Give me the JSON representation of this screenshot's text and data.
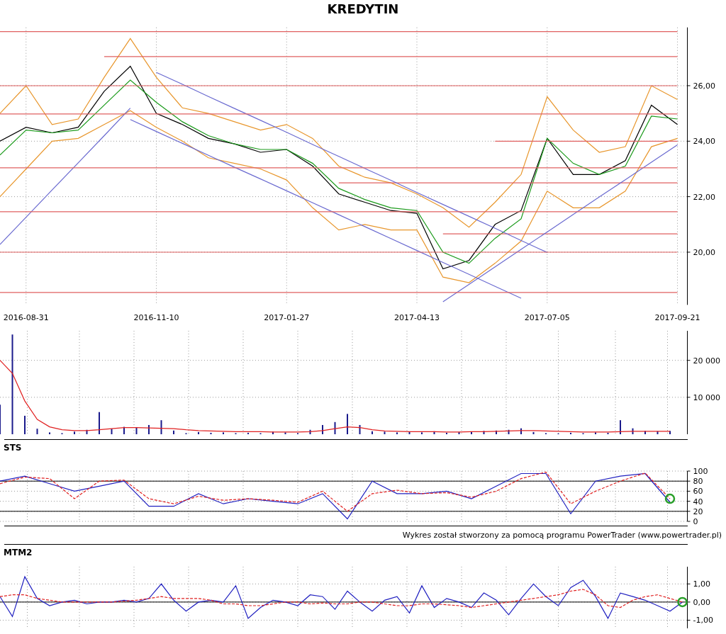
{
  "title": "KREDYTIN",
  "price": {
    "chart_data": {
      "type": "line",
      "grid": true,
      "ylim": [
        18.1,
        28.1
      ],
      "categories": [
        null,
        "2016-08-31",
        null,
        null,
        null,
        null,
        "2016-11-10",
        null,
        null,
        null,
        null,
        "2017-01-27",
        null,
        null,
        null,
        null,
        "2017-04-13",
        null,
        null,
        null,
        null,
        "2017-07-05",
        null,
        null,
        null,
        null,
        "2017-09-21"
      ],
      "yticks": [
        {
          "value": 20,
          "label": "20,00"
        },
        {
          "value": 22,
          "label": "22,00"
        },
        {
          "value": 24,
          "label": "24,00"
        },
        {
          "value": 26,
          "label": "26,00"
        }
      ],
      "series": [
        {
          "color": "#000000",
          "values": [
            24.0,
            24.5,
            24.3,
            24.5,
            25.8,
            26.7,
            25.0,
            24.6,
            24.1,
            23.9,
            23.6,
            23.7,
            23.1,
            22.1,
            21.8,
            21.5,
            21.4,
            19.4,
            19.7,
            21.0,
            21.5,
            24.1,
            22.8,
            22.8,
            23.3,
            25.3,
            24.6
          ]
        },
        {
          "color": "#1a9a1a",
          "values": [
            23.5,
            24.4,
            24.3,
            24.4,
            25.3,
            26.2,
            25.4,
            24.7,
            24.2,
            23.9,
            23.7,
            23.7,
            23.2,
            22.3,
            21.9,
            21.6,
            21.5,
            20.0,
            19.6,
            20.5,
            21.2,
            24.1,
            23.2,
            22.8,
            23.1,
            24.9,
            24.8
          ]
        },
        {
          "color": "#e8962c",
          "values": [
            25.0,
            26.0,
            24.6,
            24.8,
            26.3,
            27.7,
            26.3,
            25.2,
            25.0,
            24.7,
            24.4,
            24.6,
            24.1,
            23.1,
            22.7,
            22.5,
            22.1,
            21.6,
            20.9,
            21.8,
            22.8,
            25.6,
            24.4,
            23.6,
            23.8,
            26.0,
            25.5
          ]
        },
        {
          "color": "#e8962c",
          "values": [
            22.0,
            23.0,
            24.0,
            24.1,
            24.6,
            25.1,
            24.5,
            24.0,
            23.4,
            23.2,
            23.0,
            22.6,
            21.6,
            20.8,
            21.0,
            20.8,
            20.8,
            19.1,
            18.9,
            19.6,
            20.4,
            22.2,
            21.6,
            21.6,
            22.2,
            23.8,
            24.1
          ]
        },
        {
          "color": "#e06060",
          "values": [
            null,
            null,
            null,
            null,
            27.05,
            27.05,
            27.05,
            27.05,
            27.05,
            27.05,
            27.05,
            27.05,
            27.05,
            27.05,
            27.05,
            27.05,
            27.05,
            27.05,
            27.05,
            27.05,
            27.05,
            27.05,
            27.05,
            27.05,
            27.05,
            27.05,
            27.05
          ]
        },
        {
          "color": "#e06060",
          "values": [
            null,
            null,
            null,
            null,
            null,
            null,
            null,
            null,
            null,
            null,
            null,
            null,
            null,
            null,
            null,
            null,
            null,
            null,
            null,
            24.0,
            24.0,
            24.0,
            24.0,
            24.0,
            24.0,
            24.0,
            24.0
          ]
        },
        {
          "color": "#e06060",
          "values": [
            null,
            null,
            null,
            null,
            null,
            null,
            null,
            null,
            null,
            null,
            null,
            null,
            null,
            22.5,
            22.5,
            22.5,
            22.5,
            22.5,
            22.5,
            22.5,
            22.5,
            22.5,
            22.5,
            22.5,
            22.5,
            22.5,
            22.5
          ]
        },
        {
          "color": "#e06060",
          "values": [
            null,
            null,
            null,
            null,
            null,
            null,
            null,
            null,
            null,
            null,
            null,
            null,
            null,
            null,
            null,
            null,
            null,
            20.66,
            20.66,
            20.66,
            20.66,
            20.66,
            20.66,
            20.66,
            20.66,
            20.66,
            20.66
          ]
        },
        {
          "color": "#6a6ad0",
          "values": [
            20.28,
            21.26,
            22.24,
            23.22,
            24.2,
            25.19,
            null,
            null,
            null,
            null,
            null,
            null,
            null,
            null,
            null,
            null,
            null,
            null,
            null,
            null,
            null,
            null,
            null,
            null,
            null,
            null,
            null
          ]
        },
        {
          "color": "#6a6ad0",
          "values": [
            null,
            null,
            null,
            null,
            null,
            null,
            26.48,
            26.05,
            25.61,
            25.18,
            24.75,
            24.32,
            23.88,
            23.45,
            23.02,
            22.59,
            22.15,
            21.72,
            21.29,
            20.86,
            20.42,
            19.99,
            null,
            null,
            null,
            null,
            null
          ]
        },
        {
          "color": "#6a6ad0",
          "values": [
            null,
            null,
            null,
            null,
            null,
            24.78,
            24.35,
            23.92,
            23.49,
            23.06,
            22.64,
            22.21,
            21.78,
            21.35,
            20.92,
            20.49,
            20.06,
            19.63,
            19.2,
            18.77,
            18.34,
            null,
            null,
            null,
            null,
            null,
            null
          ]
        },
        {
          "color": "#6a6ad0",
          "values": [
            null,
            null,
            null,
            null,
            null,
            null,
            null,
            null,
            null,
            null,
            null,
            null,
            null,
            null,
            null,
            null,
            null,
            18.21,
            18.84,
            19.47,
            20.1,
            20.73,
            21.36,
            21.99,
            22.61,
            23.24,
            23.87
          ]
        },
        {
          "color": "#e06060",
          "values": [
            27.95,
            27.95,
            27.95,
            27.95,
            27.95,
            27.95,
            27.95,
            27.95,
            27.95,
            27.95,
            27.95,
            27.95,
            27.95,
            27.95,
            27.95,
            27.95,
            27.95,
            27.95,
            27.95,
            27.95,
            27.95,
            27.95,
            27.95,
            27.95,
            27.95,
            27.95,
            27.95
          ]
        },
        {
          "color": "#e06060",
          "values": [
            26.0,
            26.0,
            26.0,
            26.0,
            26.0,
            26.0,
            26.0,
            26.0,
            26.0,
            26.0,
            26.0,
            26.0,
            26.0,
            26.0,
            26.0,
            26.0,
            26.0,
            26.0,
            26.0,
            26.0,
            26.0,
            26.0,
            26.0,
            26.0,
            26.0,
            26.0,
            26.0
          ]
        },
        {
          "color": "#e06060",
          "values": [
            24.98,
            24.98,
            24.98,
            24.98,
            24.98,
            24.98,
            24.98,
            24.98,
            24.98,
            24.98,
            24.98,
            24.98,
            24.98,
            24.98,
            24.98,
            24.98,
            24.98,
            24.98,
            24.98,
            24.98,
            24.98,
            24.98,
            24.98,
            24.98,
            24.98,
            24.98,
            24.98
          ]
        },
        {
          "color": "#e06060",
          "values": [
            23.04,
            23.04,
            23.04,
            23.04,
            23.04,
            23.04,
            23.04,
            23.04,
            23.04,
            23.04,
            23.04,
            23.04,
            23.04,
            23.04,
            23.04,
            23.04,
            23.04,
            23.04,
            23.04,
            23.04,
            23.04,
            23.04,
            23.04,
            23.04,
            23.04,
            23.04,
            23.04
          ]
        },
        {
          "color": "#e06060",
          "values": [
            21.46,
            21.46,
            21.46,
            21.46,
            21.46,
            21.46,
            21.46,
            21.46,
            21.46,
            21.46,
            21.46,
            21.46,
            21.46,
            21.46,
            21.46,
            21.46,
            21.46,
            21.46,
            21.46,
            21.46,
            21.46,
            21.46,
            21.46,
            21.46,
            21.46,
            21.46,
            21.46
          ]
        },
        {
          "color": "#e06060",
          "values": [
            20.0,
            20.0,
            20.0,
            20.0,
            20.0,
            20.0,
            20.0,
            20.0,
            20.0,
            20.0,
            20.0,
            20.0,
            20.0,
            20.0,
            20.0,
            20.0,
            20.0,
            20.0,
            20.0,
            20.0,
            20.0,
            20.0,
            20.0,
            20.0,
            20.0,
            20.0,
            20.0
          ]
        },
        {
          "color": "#e06060",
          "values": [
            18.55,
            18.55,
            18.55,
            18.55,
            18.55,
            18.55,
            18.55,
            18.55,
            18.55,
            18.55,
            18.55,
            18.55,
            18.55,
            18.55,
            18.55,
            18.55,
            18.55,
            18.55,
            18.55,
            18.55,
            18.55,
            18.55,
            18.55,
            18.55,
            18.55,
            18.55,
            18.55
          ]
        }
      ]
    }
  },
  "volume": {
    "chart_data": {
      "type": "bar",
      "grid": true,
      "ylim": [
        0,
        28000
      ],
      "categories": [
        null,
        null,
        null,
        null,
        null,
        null,
        null,
        null,
        null,
        null,
        null,
        null,
        null,
        null,
        null,
        null,
        null,
        null,
        null,
        null,
        null,
        null,
        null,
        null,
        null,
        null,
        null,
        null,
        null,
        null,
        null,
        null,
        null,
        null,
        null,
        null,
        null,
        null,
        null,
        null,
        null,
        null,
        null,
        null,
        null,
        null,
        null,
        null,
        null,
        null,
        null,
        null,
        null,
        null,
        null
      ],
      "yticks": [
        {
          "value": 10000,
          "label": "10 000"
        },
        {
          "value": 20000,
          "label": "20 000"
        }
      ],
      "series": [
        {
          "color": "#1a1a8c",
          "values": [
            8000,
            27000,
            5000,
            1500,
            500,
            300,
            700,
            1200,
            6000,
            1500,
            2000,
            1800,
            2500,
            3800,
            1000,
            300,
            600,
            400,
            500,
            300,
            400,
            300,
            700,
            500,
            300,
            1200,
            2500,
            3300,
            5500,
            2500,
            800,
            700,
            500,
            600,
            500,
            800,
            400,
            600,
            700,
            900,
            1000,
            1200,
            1600,
            600,
            300,
            200,
            400,
            300,
            500,
            400,
            3800,
            1600,
            900,
            800,
            900
          ]
        },
        {
          "type": "line",
          "color": "#e02020",
          "values": [
            20000,
            16500,
            9000,
            4000,
            2000,
            1200,
            1000,
            1000,
            1200,
            1500,
            1800,
            1800,
            1700,
            1600,
            1500,
            1200,
            1000,
            900,
            800,
            700,
            700,
            700,
            600,
            600,
            600,
            700,
            1000,
            1500,
            2000,
            1800,
            1200,
            900,
            800,
            700,
            700,
            700,
            600,
            600,
            700,
            700,
            800,
            900,
            1000,
            1000,
            900,
            800,
            700,
            600,
            600,
            600,
            700,
            800,
            800,
            800,
            800
          ]
        }
      ]
    }
  },
  "sts": {
    "chart_data": {
      "type": "line",
      "title": "STS",
      "grid": true,
      "ylim": [
        0,
        100
      ],
      "categories": [
        null,
        null,
        null,
        null,
        null,
        null,
        null,
        null,
        null,
        null,
        null,
        null,
        null,
        null,
        null,
        null,
        null,
        null,
        null,
        null,
        null,
        null,
        null,
        null,
        null,
        null,
        null,
        null
      ],
      "yticks": [
        {
          "value": 0,
          "label": "0"
        },
        {
          "value": 20,
          "label": "20"
        },
        {
          "value": 40,
          "label": "40"
        },
        {
          "value": 60,
          "label": "60"
        },
        {
          "value": 80,
          "label": "80"
        },
        {
          "value": 100,
          "label": "100"
        }
      ],
      "series": [
        {
          "color": "#2020c0",
          "values": [
            80,
            90,
            75,
            60,
            70,
            80,
            30,
            30,
            55,
            35,
            45,
            40,
            35,
            55,
            5,
            80,
            55,
            55,
            60,
            45,
            70,
            95,
            95,
            15,
            80,
            90,
            95,
            38
          ]
        },
        {
          "color": "#e02020",
          "line_style": "dashed",
          "values": [
            75,
            88,
            85,
            45,
            80,
            82,
            45,
            35,
            50,
            42,
            45,
            42,
            38,
            60,
            20,
            55,
            62,
            55,
            57,
            48,
            60,
            85,
            98,
            35,
            60,
            80,
            96,
            45
          ]
        }
      ]
    }
  },
  "credit": "Wykres został stworzony za pomocą programu PowerTrader (www.powertrader.pl)",
  "mtm": {
    "chart_data": {
      "type": "line",
      "title": "MTM2",
      "grid": true,
      "ylim": [
        -1.45,
        1.95
      ],
      "categories": [
        null,
        null,
        null,
        null,
        null,
        null,
        null,
        null,
        null,
        null,
        null,
        null,
        null,
        null,
        null,
        null,
        null,
        null,
        null,
        null,
        null,
        null,
        null,
        null,
        null,
        null,
        null,
        null,
        null,
        null,
        null,
        null,
        null,
        null,
        null,
        null,
        null,
        null,
        null,
        null,
        null,
        null,
        null,
        null,
        null,
        null,
        null,
        null,
        null,
        null,
        null,
        null,
        null,
        null,
        null,
        null
      ],
      "yticks": [
        {
          "value": -1,
          "label": "-1,00"
        },
        {
          "value": 0,
          "label": "0,00"
        },
        {
          "value": 1,
          "label": "1,00"
        }
      ],
      "series": [
        {
          "color": "#2020c0",
          "values": [
            0.3,
            -0.8,
            1.4,
            0.2,
            -0.2,
            0,
            0.1,
            -0.1,
            0,
            0,
            0.1,
            0,
            0.2,
            1.0,
            0.1,
            -0.5,
            0,
            0.1,
            0,
            0.9,
            -0.9,
            -0.3,
            0.1,
            0,
            -0.2,
            0.4,
            0.3,
            -0.4,
            0.6,
            0,
            -0.5,
            0.1,
            0.3,
            -0.6,
            0.9,
            -0.3,
            0.2,
            0,
            -0.3,
            0.5,
            0.1,
            -0.7,
            0.2,
            1.0,
            0.3,
            -0.2,
            0.8,
            1.2,
            0.3,
            -0.9,
            0.5,
            0.3,
            0.1,
            -0.2,
            -0.5,
            0
          ]
        },
        {
          "color": "#e02020",
          "line_style": "dashed",
          "values": [
            0.3,
            0.4,
            0.4,
            0.2,
            0.1,
            0,
            0,
            0,
            0,
            0,
            0.05,
            0.1,
            0.2,
            0.3,
            0.2,
            0.2,
            0.2,
            0.1,
            -0.1,
            -0.1,
            -0.2,
            -0.2,
            -0.1,
            0,
            0,
            -0.1,
            -0.05,
            -0.1,
            -0.1,
            0,
            0,
            -0.1,
            -0.2,
            -0.2,
            -0.1,
            -0.1,
            -0.15,
            -0.2,
            -0.3,
            -0.2,
            -0.1,
            0,
            0.1,
            0.2,
            0.3,
            0.4,
            0.6,
            0.7,
            0.4,
            -0.2,
            -0.3,
            0.1,
            0.3,
            0.4,
            0.2,
            0
          ]
        }
      ]
    }
  }
}
